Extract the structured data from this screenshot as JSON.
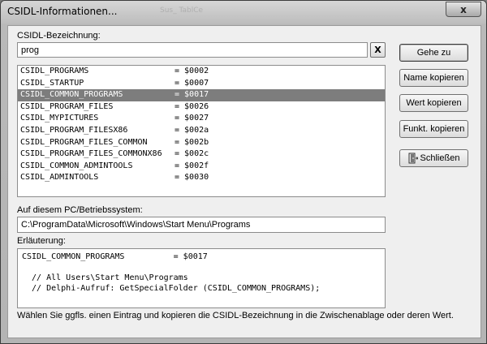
{
  "window": {
    "title": "CSIDL-Informationen...",
    "close_label": "x"
  },
  "search": {
    "label": "CSIDL-Bezeichnung:",
    "value": "prog",
    "clear_label": "X"
  },
  "list": {
    "items": [
      {
        "name": "CSIDL_PROGRAMS",
        "value": "= $0002",
        "selected": false
      },
      {
        "name": "CSIDL_STARTUP",
        "value": "= $0007",
        "selected": false
      },
      {
        "name": "CSIDL_COMMON_PROGRAMS",
        "value": "= $0017",
        "selected": true
      },
      {
        "name": "CSIDL_PROGRAM_FILES",
        "value": "= $0026",
        "selected": false
      },
      {
        "name": "CSIDL_MYPICTURES",
        "value": "= $0027",
        "selected": false
      },
      {
        "name": "CSIDL_PROGRAM_FILESX86",
        "value": "= $002a",
        "selected": false
      },
      {
        "name": "CSIDL_PROGRAM_FILES_COMMON",
        "value": "= $002b",
        "selected": false
      },
      {
        "name": "CSIDL_PROGRAM_FILES_COMMONX86",
        "value": "= $002c",
        "selected": false
      },
      {
        "name": "CSIDL_COMMON_ADMINTOOLS",
        "value": "= $002f",
        "selected": false
      },
      {
        "name": "CSIDL_ADMINTOOLS",
        "value": "= $0030",
        "selected": false
      }
    ]
  },
  "path": {
    "label": "Auf diesem PC/Betriebssystem:",
    "value": "C:\\ProgramData\\Microsoft\\Windows\\Start Menu\\Programs"
  },
  "explanation": {
    "label": "Erläuterung:",
    "lines": [
      "CSIDL_COMMON_PROGRAMS          = $0017",
      "",
      "  // All Users\\Start Menu\\Programs",
      "  // Delphi-Aufruf: GetSpecialFolder (CSIDL_COMMON_PROGRAMS);"
    ]
  },
  "hint": "Wählen Sie ggfls. einen Eintrag und kopieren die CSIDL-Bezeichnung in die Zwischenablage oder deren Wert.",
  "buttons": {
    "goto": "Gehe zu",
    "copy_name": "Name kopieren",
    "copy_value": "Wert kopieren",
    "copy_func": "Funkt. kopieren",
    "close": "Schließen"
  },
  "background": {
    "ghost_tab_text": "Sus_ TablCe"
  }
}
